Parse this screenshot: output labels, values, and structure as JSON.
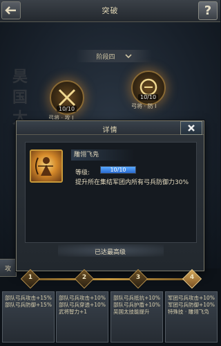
{
  "header": {
    "title": "突破",
    "back_icon": "back-arrow-icon",
    "help_label": "?"
  },
  "scene": {
    "stage_selector": "阶段四",
    "calligraphy": "昊国太",
    "nodes": [
      {
        "count": "10/10",
        "label": "弓将 · 攻 I"
      },
      {
        "count": "10/10",
        "label": "弓将 · 防 I"
      }
    ],
    "side_tab": "攻"
  },
  "popup": {
    "title": "详情",
    "close_icon": "close-x-icon",
    "skill_name": "雕翎飞凫",
    "level_label": "等级:",
    "level_value": "10/10",
    "level_progress": 1.0,
    "description": "提升所在集结军团内所有弓兵防御力30%",
    "max_level_text": "已达最高级"
  },
  "stages": [
    {
      "num": "1",
      "bonuses": [
        "部队弓兵攻击+15%",
        "部队弓兵防御+15%"
      ]
    },
    {
      "num": "2",
      "bonuses": [
        "部队弓兵攻击+10%",
        "部队弓兵穿透+10%",
        "武将智力+1"
      ]
    },
    {
      "num": "3",
      "bonuses": [
        "部队弓兵抵抗+10%",
        "部队弓兵护盾+10%",
        "吴国太技能提升"
      ]
    },
    {
      "num": "4",
      "bonuses": [
        "军团弓兵攻击+10%",
        "军团弓兵防御+10%",
        "特殊技 · 雕翎飞凫"
      ]
    }
  ],
  "colors": {
    "accent_gold": "#c89a40",
    "level_bar": "#3a8ae8"
  }
}
